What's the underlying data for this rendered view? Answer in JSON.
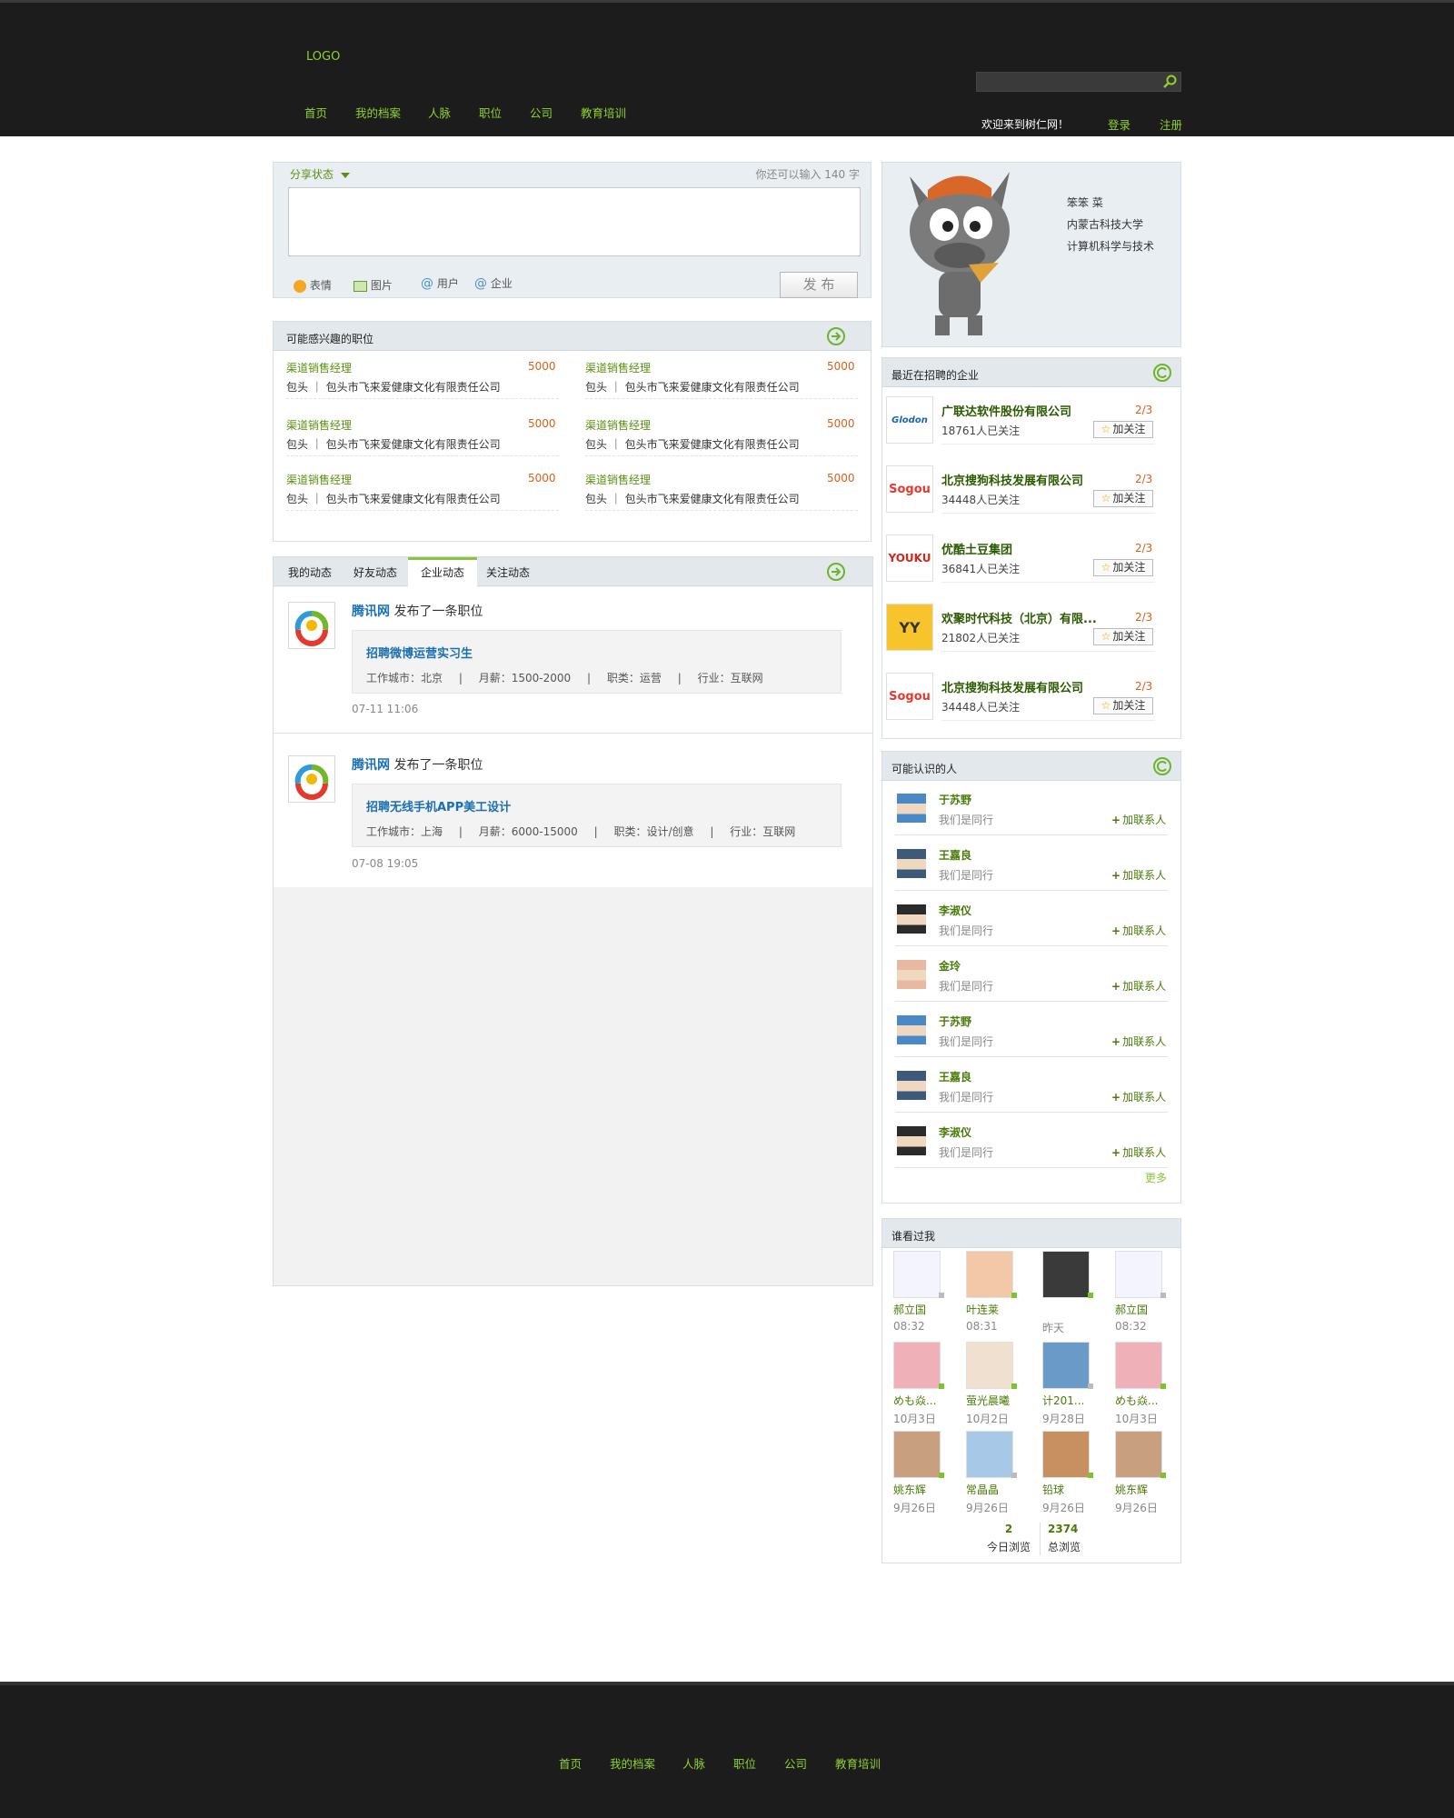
{
  "header": {
    "logo": "LOGO",
    "nav": [
      "首页",
      "我的档案",
      "人脉",
      "职位",
      "公司",
      "教育培训"
    ],
    "welcome": "欢迎来到树仁网！",
    "login": "登录",
    "register": "注册",
    "search_placeholder": ""
  },
  "status": {
    "share_label": "分享状态",
    "counter": "你还可以输入 140 字",
    "tools": [
      "表情",
      "图片",
      "用户",
      "企业"
    ],
    "publish": "发 布"
  },
  "jobs": {
    "title": "可能感兴趣的职位",
    "items": [
      {
        "title": "渠道销售经理",
        "salary": "5000",
        "company": "包头 ｜ 包头市飞来爱健康文化有限责任公司"
      },
      {
        "title": "渠道销售经理",
        "salary": "5000",
        "company": "包头 ｜ 包头市飞来爱健康文化有限责任公司"
      },
      {
        "title": "渠道销售经理",
        "salary": "5000",
        "company": "包头 ｜ 包头市飞来爱健康文化有限责任公司"
      },
      {
        "title": "渠道销售经理",
        "salary": "5000",
        "company": "包头 ｜ 包头市飞来爱健康文化有限责任公司"
      },
      {
        "title": "渠道销售经理",
        "salary": "5000",
        "company": "包头 ｜ 包头市飞来爱健康文化有限责任公司"
      },
      {
        "title": "渠道销售经理",
        "salary": "5000",
        "company": "包头 ｜ 包头市飞来爱健康文化有限责任公司"
      }
    ]
  },
  "feed": {
    "tabs": [
      "我的动态",
      "好友动态",
      "企业动态",
      "关注动态"
    ],
    "active_tab": "企业动态",
    "items": [
      {
        "company": "腾讯网",
        "action": "发布了一条职位",
        "job": "招聘微博运营实习生",
        "city": "工作城市：北京",
        "salary": "月薪：1500-2000",
        "category": "职类：运营",
        "industry": "行业：互联网",
        "time": "07-11 11:06"
      },
      {
        "company": "腾讯网",
        "action": "发布了一条职位",
        "job": "招聘无线手机APP美工设计",
        "city": "工作城市：上海",
        "salary": "月薪：6000-15000",
        "category": "职类：设计/创意",
        "industry": "行业：互联网",
        "time": "07-08 19:05"
      }
    ]
  },
  "profile": {
    "name": "笨笨 菜",
    "school": "内蒙古科技大学",
    "major": "计算机科学与技术"
  },
  "companies": {
    "title": "最近在招聘的企业",
    "follow_label": "加关注",
    "items": [
      {
        "name": "广联达软件股份有限公司",
        "followers": "18761人已关注",
        "count": "2/3",
        "logo": "Glodon"
      },
      {
        "name": "北京搜狗科技发展有限公司",
        "followers": "34448人已关注",
        "count": "2/3",
        "logo": "Sogou"
      },
      {
        "name": "优酷土豆集团",
        "followers": "36841人已关注",
        "count": "2/3",
        "logo": "YOUKU"
      },
      {
        "name": "欢聚时代科技（北京）有限...",
        "followers": "21802人已关注",
        "count": "2/3",
        "logo": "YY"
      },
      {
        "name": "北京搜狗科技发展有限公司",
        "followers": "34448人已关注",
        "count": "2/3",
        "logo": "Sogou"
      }
    ]
  },
  "people": {
    "title": "可能认识的人",
    "add_label": "加联系人",
    "more": "更多",
    "items": [
      {
        "name": "于苏野",
        "relation": "我们是同行"
      },
      {
        "name": "王嘉良",
        "relation": "我们是同行"
      },
      {
        "name": "李淑仪",
        "relation": "我们是同行"
      },
      {
        "name": "金玲",
        "relation": "我们是同行"
      },
      {
        "name": "于苏野",
        "relation": "我们是同行"
      },
      {
        "name": "王嘉良",
        "relation": "我们是同行"
      },
      {
        "name": "李淑仪",
        "relation": "我们是同行"
      }
    ]
  },
  "visitors": {
    "title": "谁看过我",
    "items": [
      {
        "name": "郝立国",
        "time": "08:32"
      },
      {
        "name": "叶连莱",
        "time": "08:31"
      },
      {
        "name": "",
        "time": "昨天"
      },
      {
        "name": "郝立国",
        "time": "08:32"
      },
      {
        "name": "めも焱...",
        "time": "10月3日"
      },
      {
        "name": "萤光晨曦",
        "time": "10月2日"
      },
      {
        "name": "计201...",
        "time": "9月28日"
      },
      {
        "name": "めも焱...",
        "time": "10月3日"
      },
      {
        "name": "姚东辉",
        "time": "9月26日"
      },
      {
        "name": "常晶晶",
        "time": "9月26日"
      },
      {
        "name": "铅球",
        "time": "9月26日"
      },
      {
        "name": "姚东辉",
        "time": "9月26日"
      }
    ],
    "today_count": "2",
    "today_label": "今日浏览",
    "total_count": "2374",
    "total_label": "总浏览"
  },
  "footer": {
    "nav": [
      "首页",
      "我的档案",
      "人脉",
      "职位",
      "公司",
      "教育培训"
    ]
  },
  "colors": {
    "accent": "#8fd22c",
    "header_bg": "#1c1c1c",
    "salary": "#d9601a",
    "link_green": "#5e8e12"
  }
}
